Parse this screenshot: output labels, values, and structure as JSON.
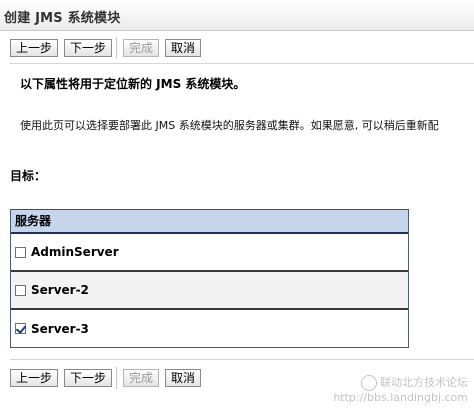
{
  "header": {
    "title": "创建 JMS 系统模块"
  },
  "buttons": {
    "back": "上一步",
    "next": "下一步",
    "finish": "完成",
    "cancel": "取消"
  },
  "intro": {
    "bold": "以下属性将用于定位新的 JMS 系统模块。",
    "text": "使用此页可以选择要部署此 JMS 系统模块的服务器或集群。如果愿意, 可以稍后重新配"
  },
  "target": {
    "label": "目标："
  },
  "table": {
    "header": "服务器",
    "rows": [
      {
        "name": "AdminServer",
        "checked": false
      },
      {
        "name": "Server-2",
        "checked": false
      },
      {
        "name": "Server-3",
        "checked": true
      }
    ]
  },
  "watermark": {
    "line1": "联动北方技术论坛",
    "line2": "http://bbs.landingbj.com"
  }
}
